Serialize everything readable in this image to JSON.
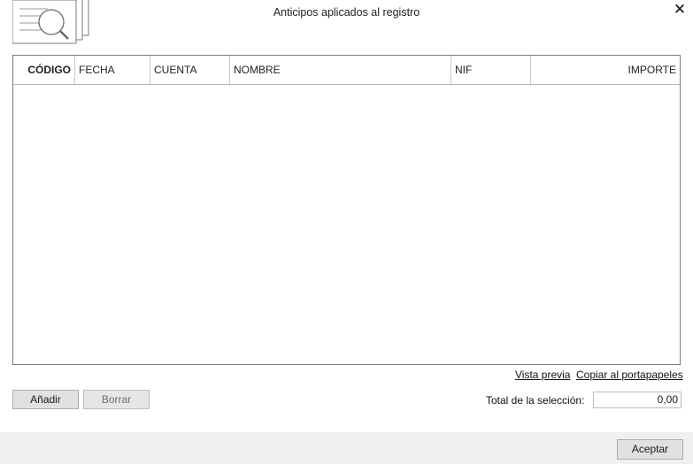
{
  "dialog": {
    "title": "Anticipos aplicados al registro",
    "icon": "document-search-icon",
    "close_icon": "close-icon"
  },
  "grid": {
    "columns": [
      "CÓDIGO",
      "FECHA",
      "CUENTA",
      "NOMBRE",
      "NIF",
      "IMPORTE"
    ],
    "rows": []
  },
  "links": {
    "preview": "Vista previa",
    "copy": "Copiar al portapapeles"
  },
  "buttons": {
    "add": "Añadir",
    "delete": "Borrar",
    "accept": "Aceptar"
  },
  "totals": {
    "label": "Total de la selección:",
    "value": "0,00"
  }
}
